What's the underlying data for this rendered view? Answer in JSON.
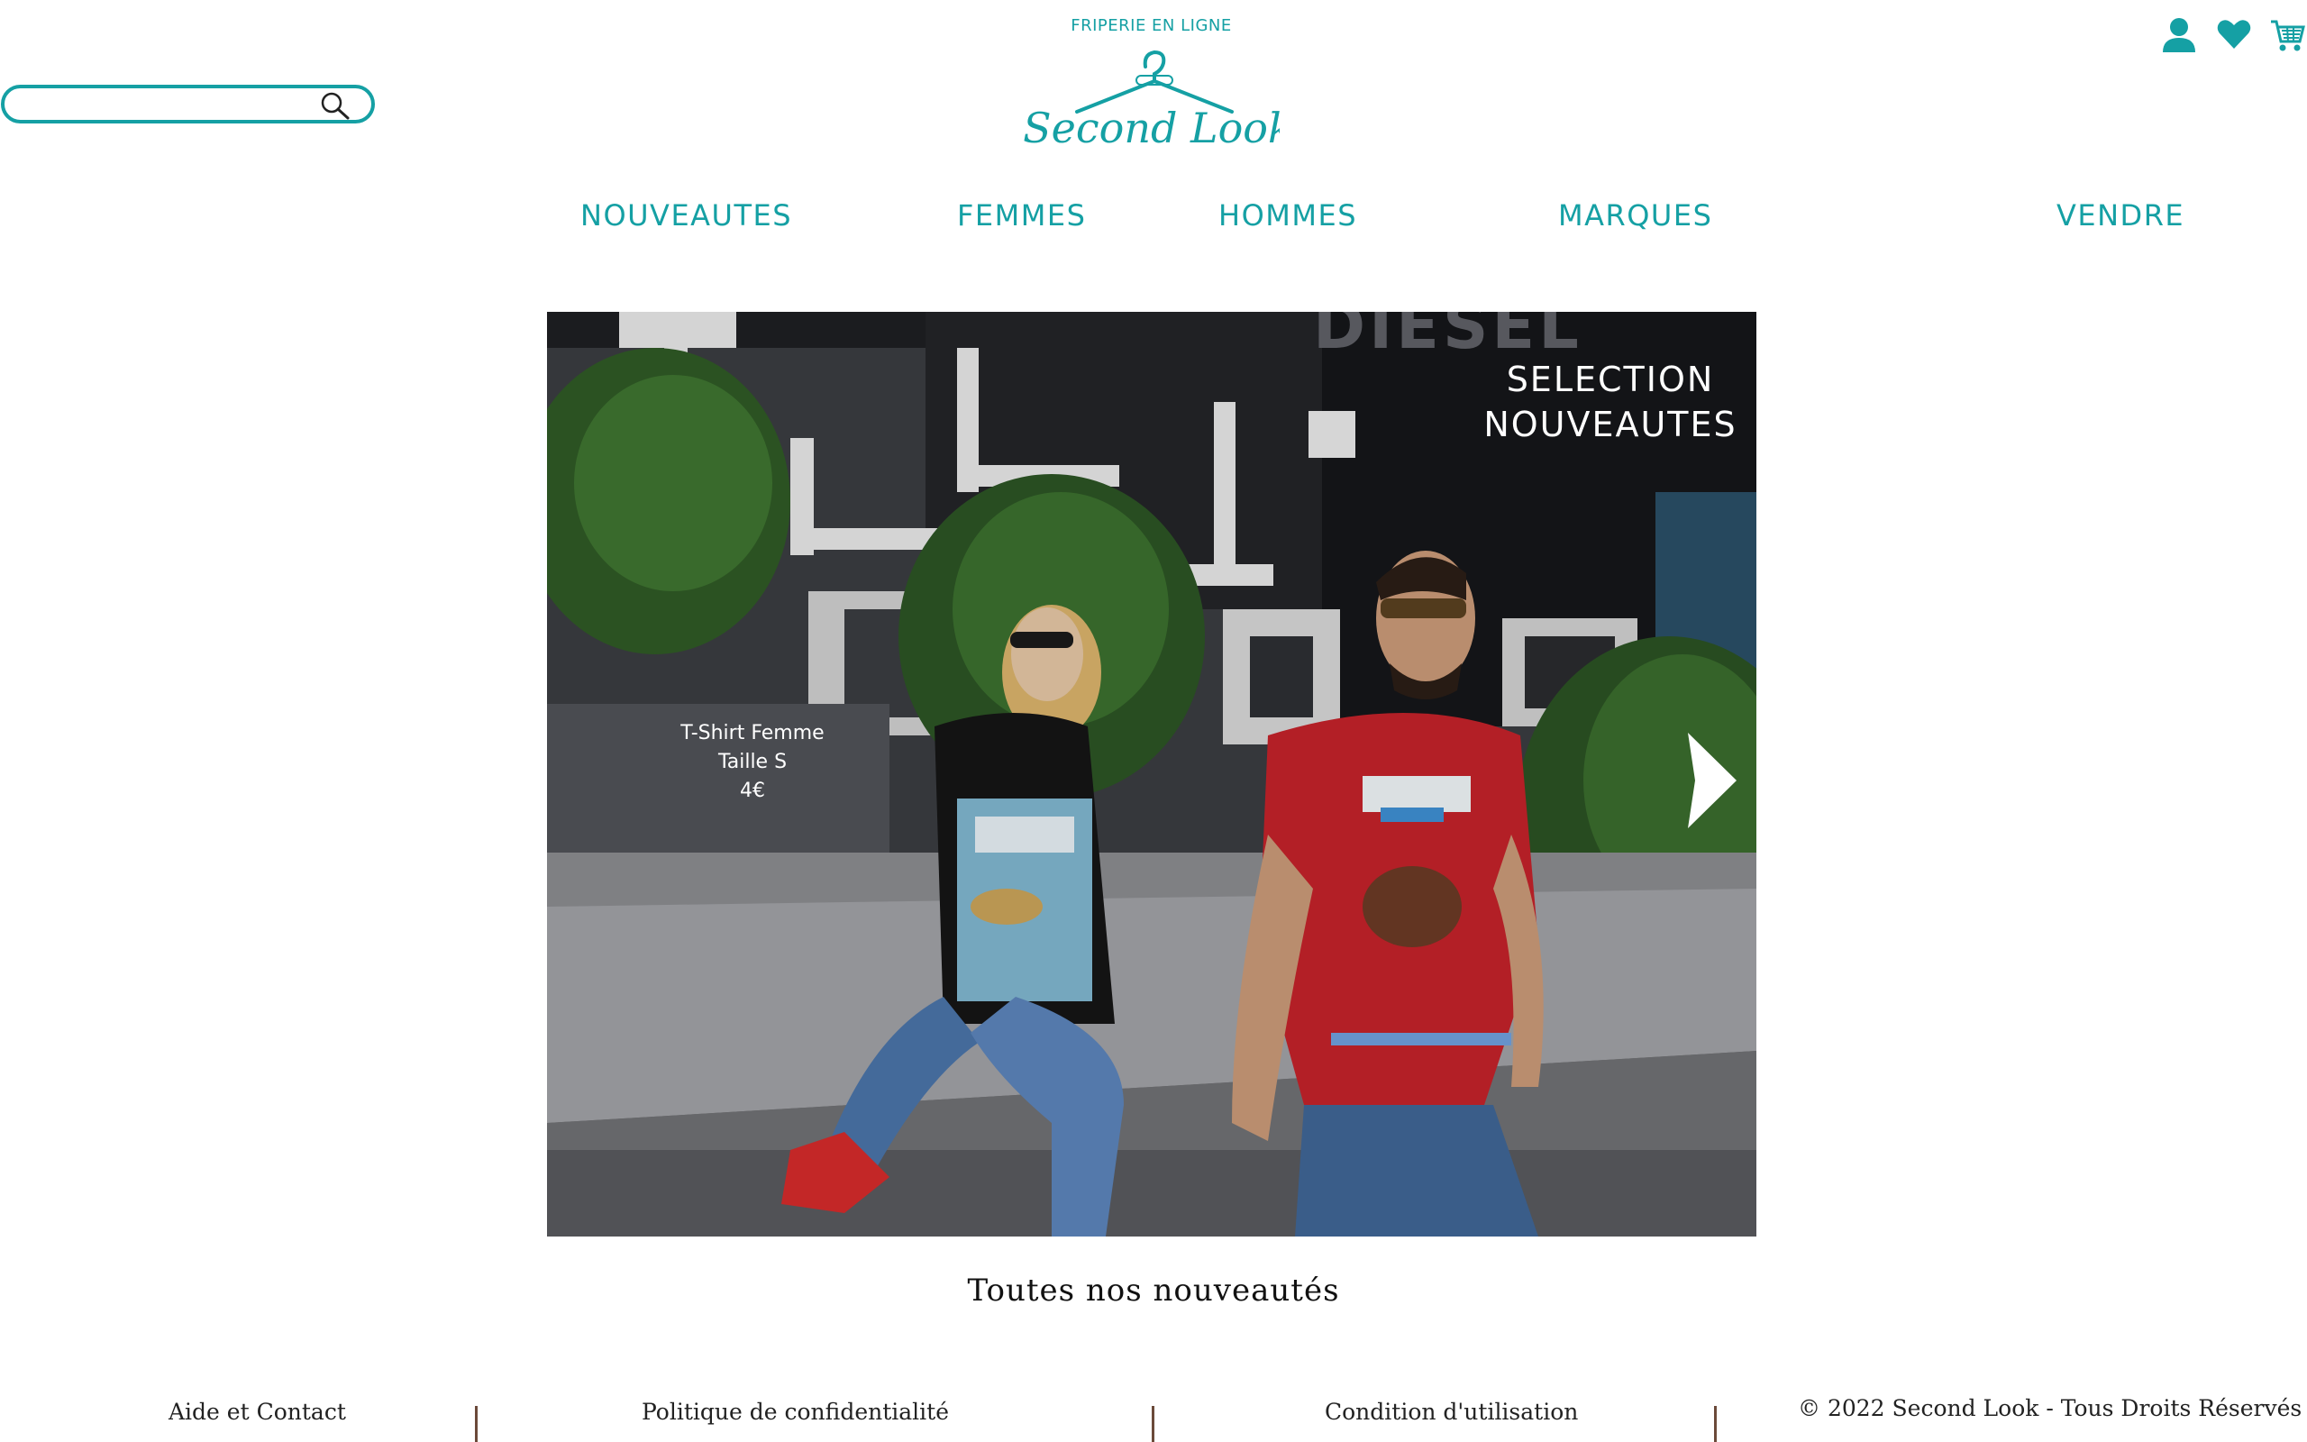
{
  "header": {
    "tagline": "FRIPERIE EN LIGNE",
    "logo_text": "Second Look",
    "search": {
      "value": "",
      "placeholder": ""
    }
  },
  "top_icons": [
    "user-icon",
    "heart-icon",
    "cart-icon"
  ],
  "nav": {
    "items": [
      "NOUVEAUTES",
      "FEMMES",
      "HOMMES",
      "MARQUES",
      "VENDRE"
    ]
  },
  "hero": {
    "title_line1": "SELECTION",
    "title_line2": "NOUVEAUTES",
    "wall_sign": "DIESEL",
    "product": {
      "name": "T-Shirt Femme",
      "size": "Taille S",
      "price": "4€"
    }
  },
  "section_link": "Toutes nos nouveautés",
  "footer": {
    "links": [
      "Aide et Contact",
      "Politique de confidentialité",
      "Condition d'utilisation"
    ],
    "copyright": "© 2022 Second Look - Tous Droits Réservés"
  },
  "colors": {
    "accent": "#15a0a4",
    "separator": "#6b4a3a"
  }
}
